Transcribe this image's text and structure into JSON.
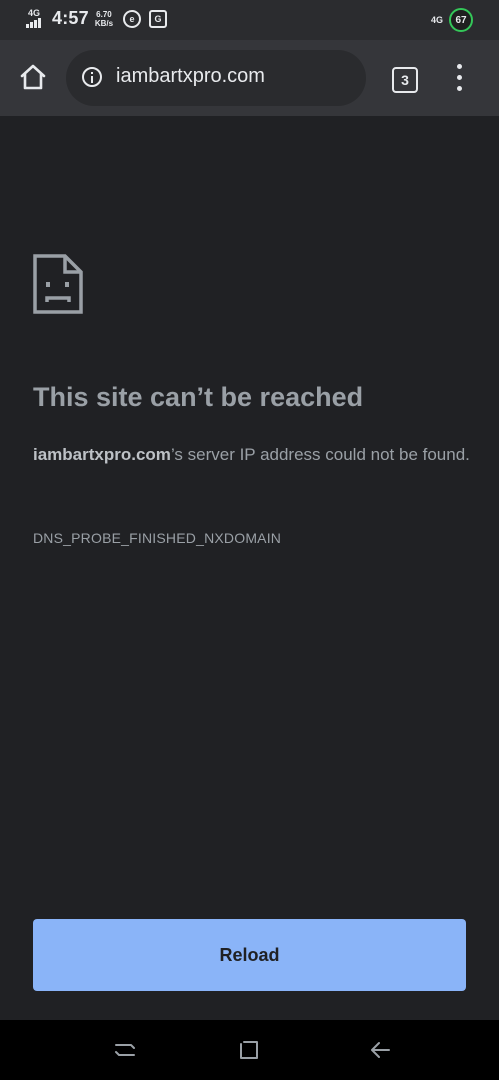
{
  "status_bar": {
    "network_left": "4G",
    "time": "4:57",
    "speed_value": "6.70",
    "speed_unit": "KB/s",
    "notif_icon_1": "e",
    "notif_icon_2": "G",
    "network_right": "4G",
    "battery": "67"
  },
  "toolbar": {
    "url": "iambartxpro.com",
    "tab_count": "3",
    "icons": [
      "home-icon",
      "info-icon",
      "tab-switcher-icon",
      "more-vert-icon"
    ]
  },
  "error_page": {
    "title": "This site can’t be reached",
    "host": "iambartxpro.com",
    "message_suffix": "’s server IP address could not be found.",
    "error_code": "DNS_PROBE_FINISHED_NXDOMAIN",
    "reload_label": "Reload",
    "icon": "sad-document-icon"
  },
  "nav_bar": {
    "icons": [
      "recents-icon",
      "home-square-icon",
      "back-arrow-icon"
    ]
  },
  "colors": {
    "background": "#202124",
    "toolbar": "#35363a",
    "reload_button": "#8ab4f8",
    "battery_ring": "#34c759"
  }
}
